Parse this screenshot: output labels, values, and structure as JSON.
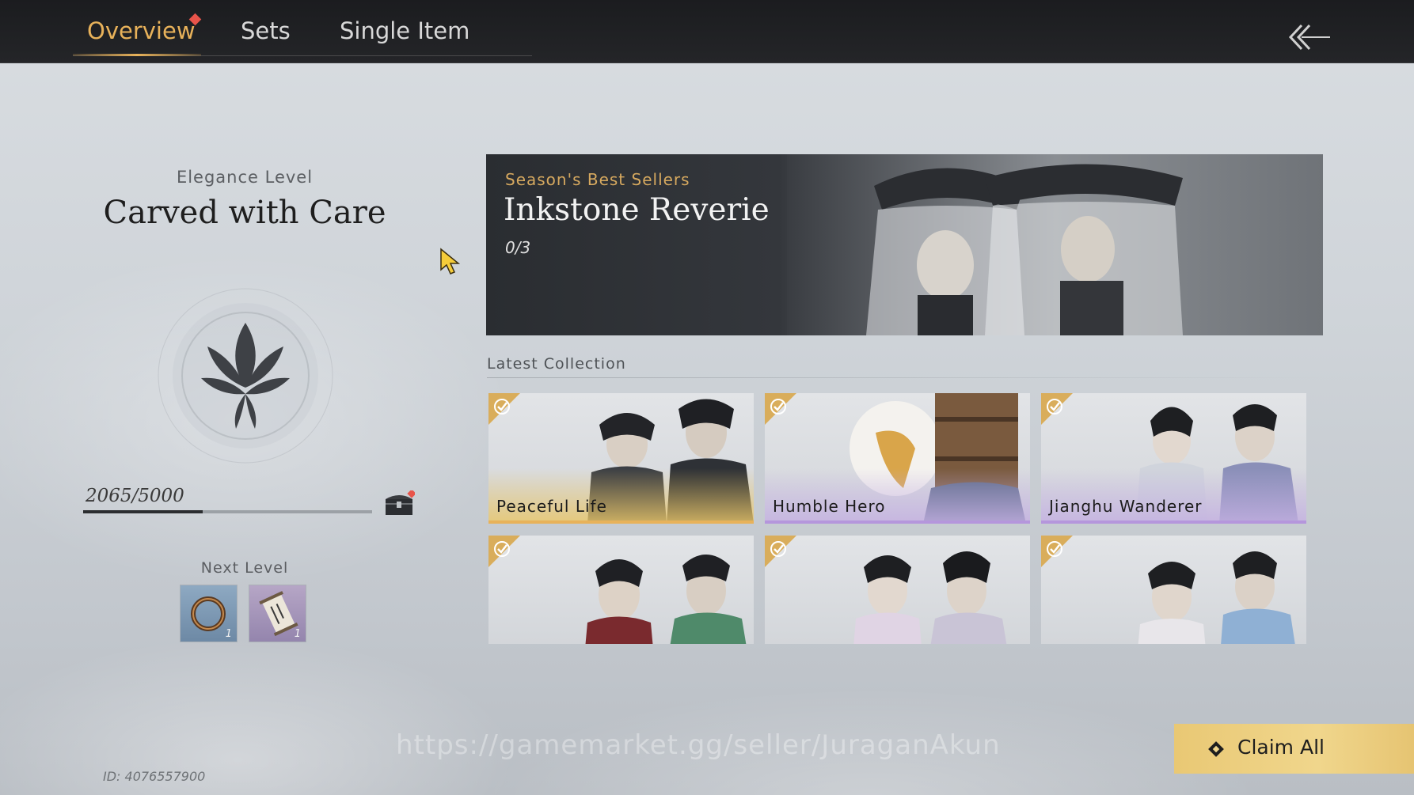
{
  "tabs": [
    {
      "label": "Overview",
      "active": true,
      "badge": true
    },
    {
      "label": "Sets",
      "active": false
    },
    {
      "label": "Single Item",
      "active": false
    }
  ],
  "back_icon": "double-chevron-left-icon",
  "left_panel": {
    "elegance_label": "Elegance Level",
    "elegance_title": "Carved with Care",
    "emblem_icon": "lotus-emblem-icon",
    "progress_text": "2065/5000",
    "progress_fraction": 0.413,
    "chest_icon": "treasure-chest-icon",
    "next_level_label": "Next Level",
    "rewards": [
      {
        "icon": "bracelet-icon",
        "count": "1"
      },
      {
        "icon": "scroll-icon",
        "count": "1"
      }
    ]
  },
  "banner": {
    "subtitle": "Season's Best Sellers",
    "title": "Inkstone Reverie",
    "count": "0/3"
  },
  "collection": {
    "label": "Latest Collection",
    "items": [
      {
        "name": "Peaceful Life",
        "claimed": true
      },
      {
        "name": "Humble Hero",
        "claimed": true
      },
      {
        "name": "Jianghu Wanderer",
        "claimed": true
      },
      {
        "name": "",
        "claimed": true
      },
      {
        "name": "",
        "claimed": true
      },
      {
        "name": "",
        "claimed": true
      }
    ]
  },
  "watermark": "https://gamemarket.gg/seller/JuraganAkun",
  "claim_button": {
    "label": "Claim All",
    "icon": "diamond-icon"
  },
  "player_id": "ID: 4076557900",
  "colors": {
    "accent": "#e8b25a",
    "badge": "#e8544a",
    "claim": "#f0d68c"
  }
}
